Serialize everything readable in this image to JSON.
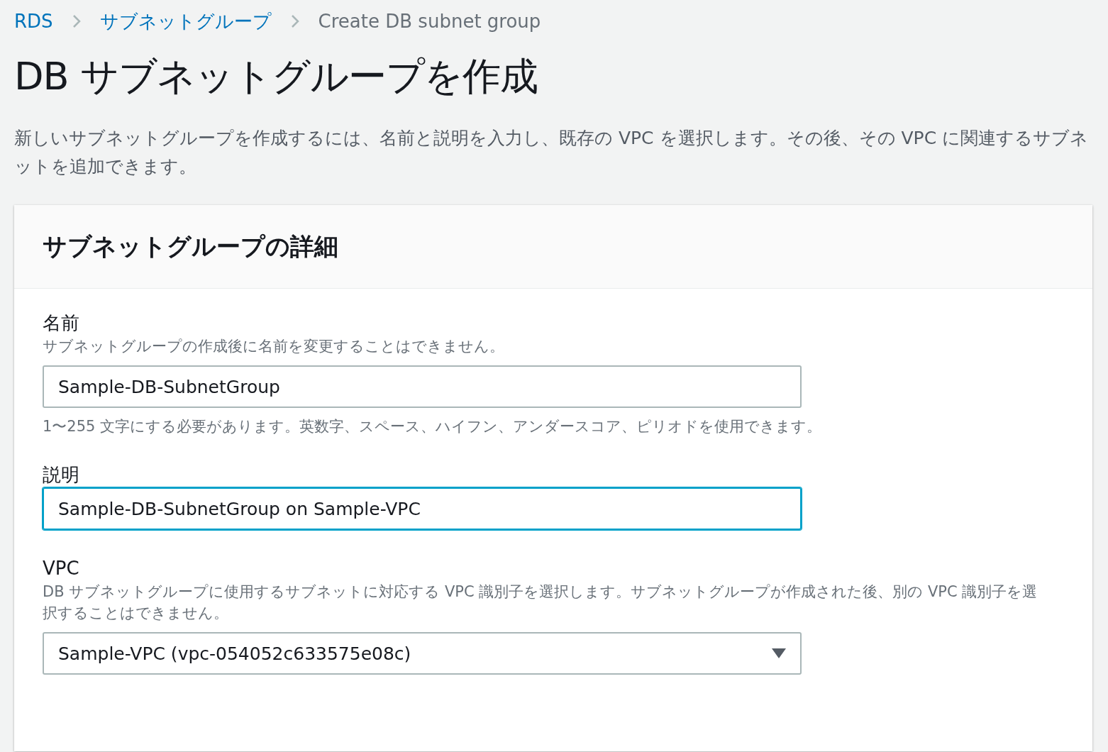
{
  "breadcrumb": [
    {
      "label": "RDS",
      "kind": "link"
    },
    {
      "label": "サブネットグループ",
      "kind": "link"
    },
    {
      "label": "Create DB subnet group",
      "kind": "current"
    }
  ],
  "title": "DB サブネットグループを作成",
  "intro": "新しいサブネットグループを作成するには、名前と説明を入力し、既存の VPC を選択します。その後、その VPC に関連するサブネットを追加できます。",
  "panel": {
    "title": "サブネットグループの詳細",
    "fields": [
      {
        "kind": "text",
        "label": "名前",
        "description": "サブネットグループの作成後に名前を変更することはできません。",
        "value": "Sample-DB-SubnetGroup",
        "focused": false,
        "hint": "1〜255 文字にする必要があります。英数字、スペース、ハイフン、アンダースコア、ピリオドを使用できます。"
      },
      {
        "kind": "text",
        "label": "説明",
        "value": "Sample-DB-SubnetGroup on Sample-VPC",
        "focused": true
      },
      {
        "kind": "select",
        "label": "VPC",
        "description": "DB サブネットグループに使用するサブネットに対応する VPC 識別子を選択します。サブネットグループが作成された後、別の VPC 識別子を選択することはできません。",
        "value": "Sample-VPC (vpc-054052c633575e08c)",
        "focused": false
      }
    ]
  }
}
